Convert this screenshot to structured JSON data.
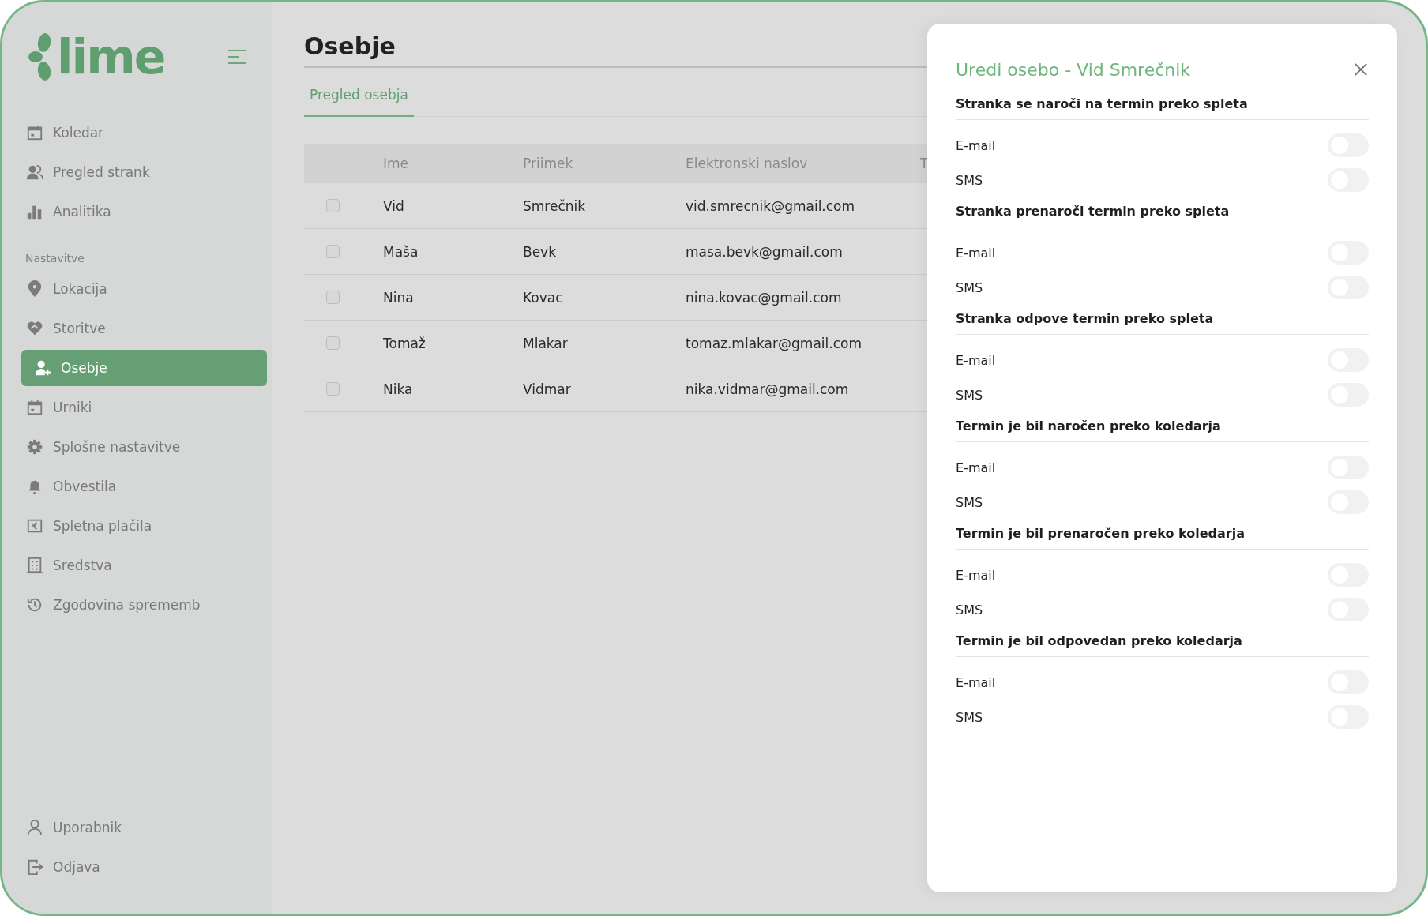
{
  "logo": {
    "text": "lime"
  },
  "sidebar": {
    "groups": [
      {
        "items": [
          {
            "label": "Koledar",
            "selected": false
          },
          {
            "label": "Pregled strank",
            "selected": false
          },
          {
            "label": "Analitika",
            "selected": false
          }
        ]
      },
      {
        "label": "Nastavitve",
        "items": [
          {
            "label": "Lokacija",
            "selected": false
          },
          {
            "label": "Storitve",
            "selected": false
          },
          {
            "label": "Osebje",
            "selected": true
          },
          {
            "label": "Urniki",
            "selected": false
          },
          {
            "label": "Splošne nastavitve",
            "selected": false
          },
          {
            "label": "Obvestila",
            "selected": false
          },
          {
            "label": "Spletna plačila",
            "selected": false
          },
          {
            "label": "Sredstva",
            "selected": false
          },
          {
            "label": "Zgodovina sprememb",
            "selected": false
          }
        ]
      }
    ],
    "footer_items": [
      {
        "label": "Uporabnik",
        "selected": false
      },
      {
        "label": "Odjava",
        "selected": false
      }
    ]
  },
  "page": {
    "title": "Osebje",
    "tabs": [
      {
        "label": "Pregled osebja",
        "selected": true
      }
    ]
  },
  "table": {
    "columns": [
      "Ime",
      "Priimek",
      "Elektronski naslov",
      "T"
    ],
    "rows": [
      {
        "checked": false,
        "cells": [
          "Vid",
          "Smrečnik",
          "vid.smrecnik@gmail.com"
        ]
      },
      {
        "checked": false,
        "cells": [
          "Maša",
          "Bevk",
          "masa.bevk@gmail.com"
        ]
      },
      {
        "checked": false,
        "cells": [
          "Nina",
          "Kovac",
          "nina.kovac@gmail.com"
        ]
      },
      {
        "checked": false,
        "cells": [
          "Tomaž",
          "Mlakar",
          "tomaz.mlakar@gmail.com"
        ]
      },
      {
        "checked": false,
        "cells": [
          "Nika",
          "Vidmar",
          "nika.vidmar@gmail.com"
        ]
      }
    ]
  },
  "panel": {
    "title": "Uredi osebo - Vid Smrečnik",
    "sections": [
      {
        "heading": "Stranka se naroči na termin preko spleta",
        "options": [
          {
            "label": "E-mail",
            "on": false
          },
          {
            "label": "SMS",
            "on": false
          }
        ]
      },
      {
        "heading": "Stranka prenaroči termin preko spleta",
        "options": [
          {
            "label": "E-mail",
            "on": false
          },
          {
            "label": "SMS",
            "on": false
          }
        ]
      },
      {
        "heading": "Stranka odpove termin preko spleta",
        "options": [
          {
            "label": "E-mail",
            "on": false
          },
          {
            "label": "SMS",
            "on": false
          }
        ]
      },
      {
        "heading": "Termin je bil naročen preko koledarja",
        "options": [
          {
            "label": "E-mail",
            "on": false
          },
          {
            "label": "SMS",
            "on": false
          }
        ]
      },
      {
        "heading": "Termin je bil prenaročen preko koledarja",
        "options": [
          {
            "label": "E-mail",
            "on": false
          },
          {
            "label": "SMS",
            "on": false
          }
        ]
      },
      {
        "heading": "Termin je bil odpovedan preko koledarja",
        "options": [
          {
            "label": "E-mail",
            "on": false
          },
          {
            "label": "SMS",
            "on": false
          }
        ]
      }
    ]
  }
}
